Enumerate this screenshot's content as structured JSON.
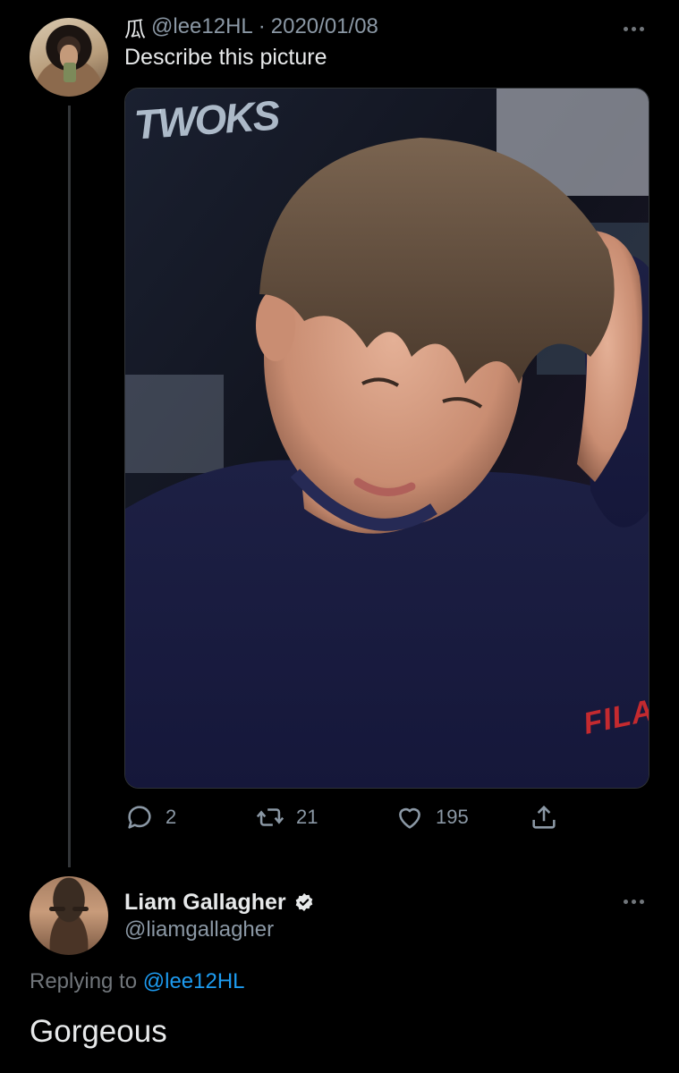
{
  "tweet": {
    "author_glyph": "瓜",
    "handle": "@lee12HL",
    "separator": "·",
    "date": "2020/01/08",
    "text": "Describe this picture",
    "photo": {
      "brand_text": "FILA",
      "sign_text": "TWOKS"
    },
    "actions": {
      "reply_count": "2",
      "retweet_count": "21",
      "like_count": "195"
    }
  },
  "reply": {
    "display_name": "Liam Gallagher",
    "handle": "@liamgallagher",
    "replying_prefix": "Replying to",
    "replying_to": "@lee12HL",
    "text": "Gorgeous"
  },
  "colors": {
    "background": "#000000",
    "text_primary": "#e7e9ea",
    "text_secondary": "#8b98a5",
    "link": "#1d9bf0",
    "thread_line": "#333639"
  },
  "icons": [
    "more-icon",
    "reply-icon",
    "retweet-icon",
    "like-icon",
    "share-icon",
    "verified-badge-icon"
  ]
}
